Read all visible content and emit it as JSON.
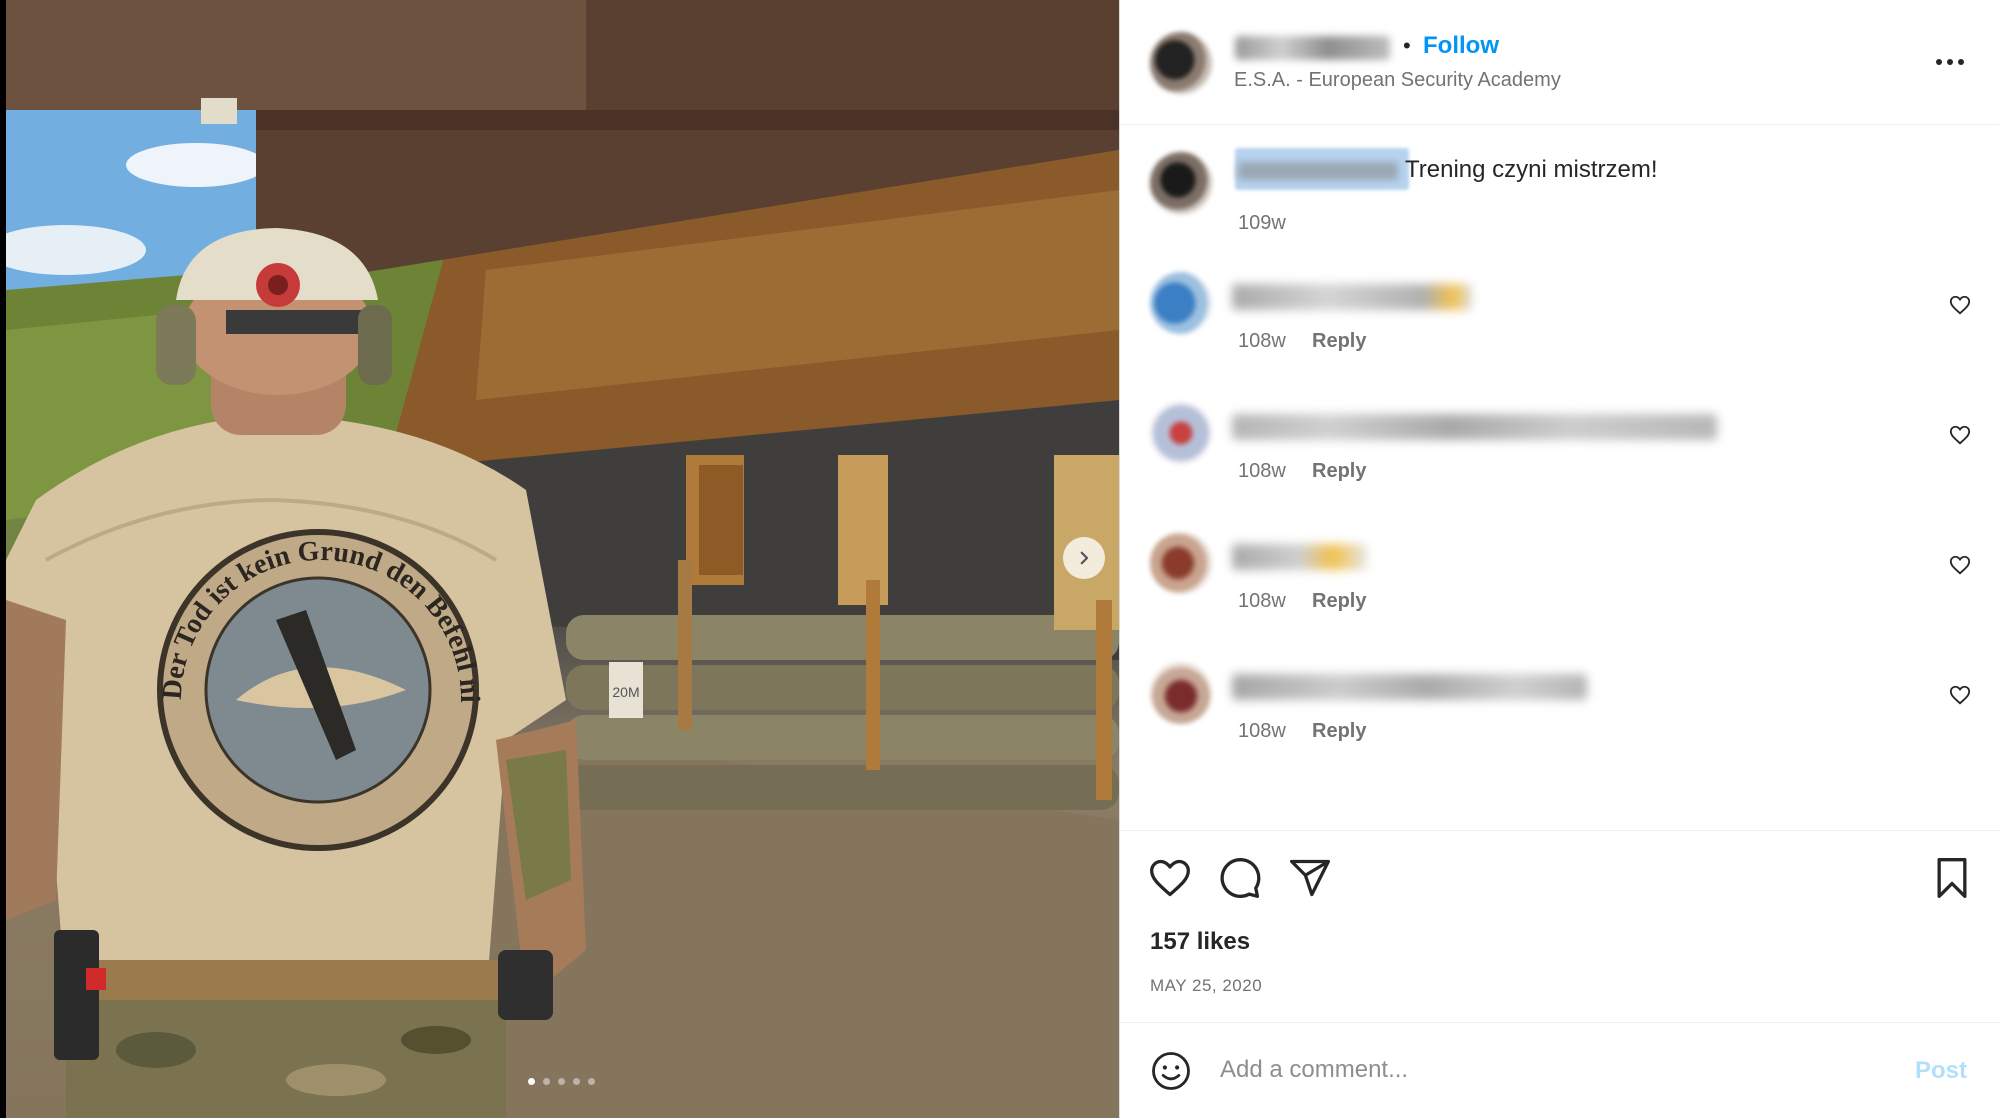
{
  "photo": {
    "shirt_text": "Der Tod ist kein Grund den Befehl nicht auszuführen",
    "sign_text": "20M",
    "next_icon": "chevron-right-icon",
    "slide_count": 5,
    "active_slide": 1
  },
  "header": {
    "separator": "•",
    "follow_label": "Follow",
    "location": "E.S.A. - European Security Academy",
    "more_icon": "more-horizontal-icon"
  },
  "caption": {
    "text": "Trening czyni mistrzem!",
    "time": "109w"
  },
  "comments": [
    {
      "time": "108w",
      "reply": "Reply"
    },
    {
      "time": "108w",
      "reply": "Reply"
    },
    {
      "time": "108w",
      "reply": "Reply"
    },
    {
      "time": "108w",
      "reply": "Reply"
    }
  ],
  "actions": {
    "like_icon": "heart-icon",
    "comment_icon": "comment-icon",
    "share_icon": "paper-plane-icon",
    "save_icon": "bookmark-icon",
    "likes": "157 likes",
    "date": "MAY 25, 2020"
  },
  "compose": {
    "emoji_icon": "smiley-icon",
    "placeholder": "Add a comment...",
    "post_label": "Post"
  },
  "colors": {
    "accent": "#0095f6",
    "post_disabled": "#b2dffc",
    "secondary_text": "#737373",
    "primary_text": "#262626"
  }
}
